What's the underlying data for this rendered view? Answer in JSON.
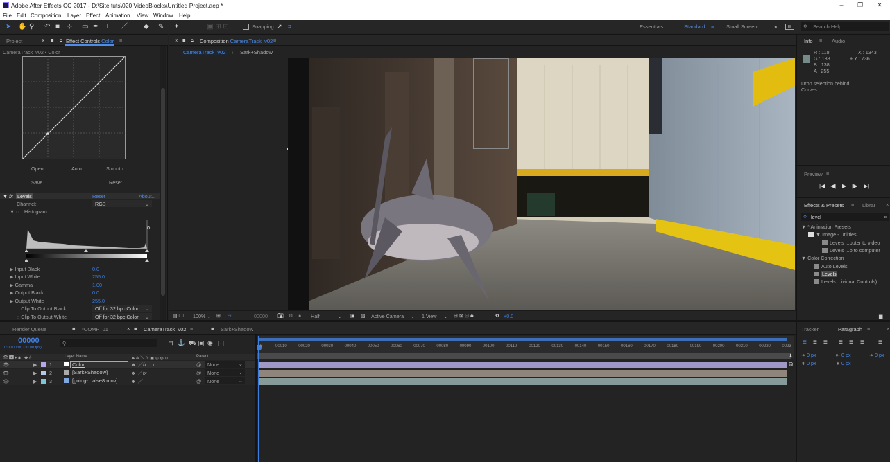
{
  "window": {
    "title": "Adobe After Effects CC 2017 - D:\\Site tuts\\020 VideoBlocks\\Untitled Project.aep *",
    "controls": {
      "minimize": "–",
      "restore": "❐",
      "close": "✕"
    }
  },
  "menu": [
    "File",
    "Edit",
    "Composition",
    "Layer",
    "Effect",
    "Animation",
    "View",
    "Window",
    "Help"
  ],
  "toolbar": {
    "snapping": "Snapping",
    "workspaces": [
      "Essentials",
      "Standard",
      "Small Screen"
    ],
    "active_workspace": "Standard",
    "overflow": "»",
    "search_placeholder": "Search Help"
  },
  "left_panel": {
    "tabs": [
      "Project",
      "Effect Controls"
    ],
    "effect_controls_layer": "Color",
    "subtitle": "CameraTrack_v02 • Color",
    "curves_buttons": [
      "Open...",
      "Auto",
      "Smooth",
      "Save...",
      "Reset"
    ],
    "levels": {
      "name": "Levels",
      "reset": "Reset",
      "about": "About...",
      "channel_label": "Channel:",
      "channel_value": "RGB",
      "histogram_label": "Histogram",
      "props": [
        {
          "name": "Input Black",
          "value": "0.0"
        },
        {
          "name": "Input White",
          "value": "255.0"
        },
        {
          "name": "Gamma",
          "value": "1.00"
        },
        {
          "name": "Output Black",
          "value": "0.0"
        },
        {
          "name": "Output White",
          "value": "255.0"
        }
      ],
      "clips": [
        {
          "name": "Clip To Output Black",
          "value": "Off for 32 bpc Color"
        },
        {
          "name": "Clip To Output White",
          "value": "Off for 32 bpc Color"
        }
      ]
    }
  },
  "composition": {
    "panel_label": "Composition",
    "comp_name": "CameraTrack_v02",
    "breadcrumbs": [
      "CameraTrack_v02",
      "Sark+Shadow"
    ],
    "footer": {
      "zoom": "100%",
      "timecode": "00000",
      "resolution": "Half",
      "camera": "Active Camera",
      "view": "1 View",
      "exposure": "+0.0"
    }
  },
  "right_panel": {
    "info_tabs": [
      "Info",
      "Audio"
    ],
    "info": {
      "r": "R : 118",
      "g": "G : 138",
      "b": "B : 138",
      "a": "A : 255",
      "x": "X : 1343",
      "y": "+ Y : 736"
    },
    "info_text": [
      "Drop selection behind:",
      "Curves"
    ],
    "preview_label": "Preview",
    "preview_controls": [
      "|◀",
      "◀|",
      "▶",
      "|▶",
      "▶|"
    ],
    "effects_tabs": [
      "Effects & Presets",
      "Librar"
    ],
    "search_value": "level",
    "tree": [
      "▼ * Animation Presets",
      "▼ Image - Utilities",
      "Levels ...puter to video",
      "Levels ...o to computer",
      "▼ Color Correction",
      "Auto Levels",
      "Levels",
      "Levels ...ividual Controls)"
    ],
    "bottom_tabs": [
      "Tracker",
      "Paragraph"
    ],
    "paragraph_values": [
      "0 px",
      "0 px",
      "0 px",
      "0 px",
      "0 px"
    ]
  },
  "timeline": {
    "tabs": [
      "Render Queue",
      "*COMP_01",
      "CameraTrack_v02",
      "Sark+Shadow"
    ],
    "timecode": "00000",
    "timecode_sub": "0:00:00:00 (30.00 fps)",
    "search_placeholder": "",
    "col_layer_name": "Layer Name",
    "col_parent": "Parent",
    "layers": [
      {
        "num": "1",
        "name": "Color",
        "parent": "None",
        "color": "#b5a7e6",
        "bar": "#9f97c6"
      },
      {
        "num": "2",
        "name": "[Sark+Shadow]",
        "parent": "None",
        "color": "#b9c7e7",
        "bar": "#a0948a"
      },
      {
        "num": "3",
        "name": "[going-...alse8.mov]",
        "parent": "None",
        "color": "#7cc6d6",
        "bar": "#8aa0a0"
      }
    ],
    "ticks": [
      "00010",
      "00020",
      "00030",
      "00040",
      "00050",
      "00060",
      "00070",
      "00080",
      "00090",
      "00100",
      "00110",
      "00120",
      "00130",
      "00140",
      "00150",
      "00160",
      "00170",
      "00180",
      "00190",
      "00200",
      "00210",
      "00220",
      "0023"
    ],
    "start_tick": "0"
  }
}
